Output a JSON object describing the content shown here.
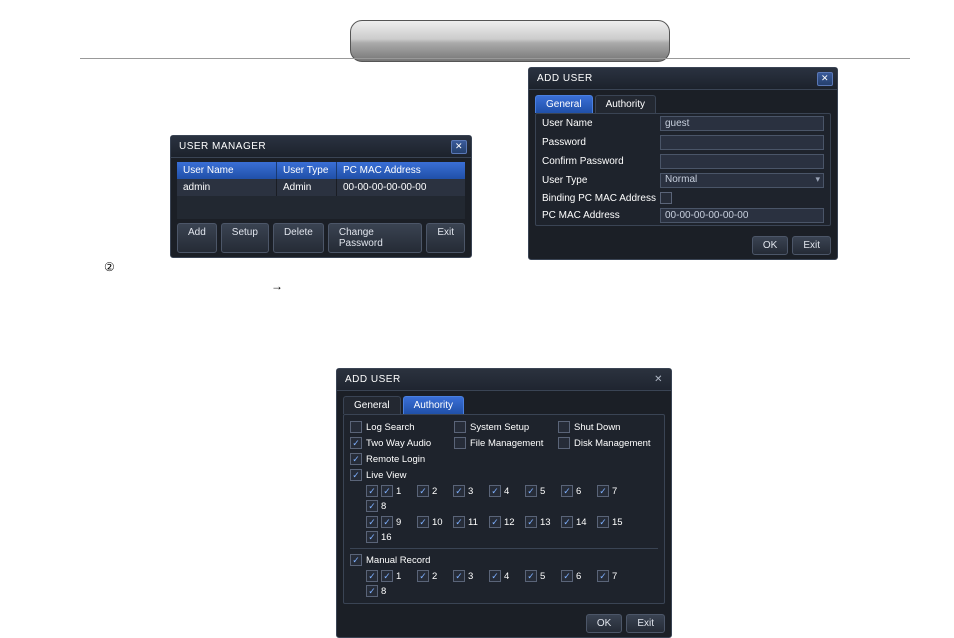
{
  "user_manager": {
    "title": "USER  MANAGER",
    "columns": [
      "User Name",
      "User Type",
      "PC MAC Address"
    ],
    "rows": [
      {
        "name": "admin",
        "type": "Admin",
        "mac": "00-00-00-00-00-00"
      }
    ],
    "buttons": {
      "add": "Add",
      "setup": "Setup",
      "delete": "Delete",
      "change_pw": "Change Password",
      "exit": "Exit"
    }
  },
  "add_user_general": {
    "title": "ADD USER",
    "tabs": {
      "general": "General",
      "authority": "Authority"
    },
    "fields": {
      "user_name_label": "User Name",
      "user_name_value": "guest",
      "password_label": "Password",
      "password_value": "",
      "confirm_label": "Confirm Password",
      "confirm_value": "",
      "user_type_label": "User Type",
      "user_type_value": "Normal",
      "bind_mac_label": "Binding PC MAC Address",
      "mac_label": "PC MAC Address",
      "mac_value": "00-00-00-00-00-00"
    },
    "buttons": {
      "ok": "OK",
      "exit": "Exit"
    }
  },
  "add_user_authority": {
    "title": "ADD USER",
    "tabs": {
      "general": "General",
      "authority": "Authority"
    },
    "perms": {
      "log_search": "Log Search",
      "system_setup": "System Setup",
      "shut_down": "Shut Down",
      "two_way_audio": "Two Way Audio",
      "file_management": "File Management",
      "disk_management": "Disk Management",
      "remote_login": "Remote Login",
      "live_view": "Live View",
      "manual_record": "Manual Record"
    },
    "channels_row1": [
      "1",
      "2",
      "3",
      "4",
      "5",
      "6",
      "7",
      "8"
    ],
    "channels_row2": [
      "9",
      "10",
      "11",
      "12",
      "13",
      "14",
      "15",
      "16"
    ],
    "channels_row3": [
      "1",
      "2",
      "3",
      "4",
      "5",
      "6",
      "7",
      "8"
    ],
    "buttons": {
      "ok": "OK",
      "exit": "Exit"
    }
  }
}
